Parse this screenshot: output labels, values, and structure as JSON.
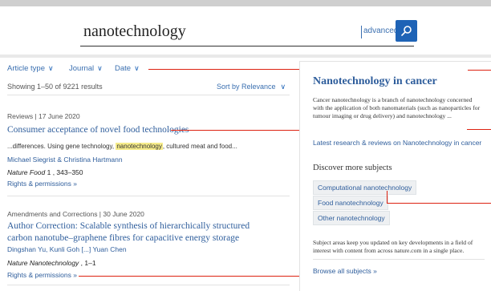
{
  "search": {
    "query": "nanotechnology",
    "advanced_label": "advanced"
  },
  "filters": [
    {
      "label": "Article type"
    },
    {
      "label": "Journal"
    },
    {
      "label": "Date"
    }
  ],
  "results_header": {
    "showing": "Showing 1–50 of 9221 results",
    "sort": "Sort by Relevance"
  },
  "results": [
    {
      "meta": "Reviews  |  17 June 2020",
      "title": "Consumer acceptance of novel food technologies",
      "snippet_before": "...differences. Using gene technology, ",
      "snippet_highlight": "nanotechnology",
      "snippet_after": ", cultured meat and food...",
      "authors": "Michael Siegrist & Christina Hartmann",
      "journal_name": "Nature Food",
      "journal_rest": " 1 , 343–350",
      "rights": "Rights & permissions »"
    },
    {
      "meta": "Amendments and Corrections  |  30 June 2020",
      "title": "Author Correction: Scalable synthesis of hierarchically structured carbon nanotube–graphene fibres for capacitive energy storage",
      "authors": "Dingshan Yu, Kunli Goh  [...]  Yuan Chen",
      "journal_name": "Nature Nanotechnology",
      "journal_rest": " , 1–1",
      "rights": "Rights & permissions »"
    }
  ],
  "panel": {
    "title": "Nanotechnology in cancer",
    "description": "Cancer nanotechnology is a branch of nanotechnology concerned with the application of both nanomaterials (such as nanoparticles for tumour imaging or drug delivery) and nanotechnology ...",
    "latest_link": "Latest research & reviews on Nanotechnology in cancer",
    "discover_heading": "Discover more subjects",
    "subjects": [
      "Computational nanotechnology",
      "Food nanotechnology",
      "Other nanotechnology"
    ],
    "note": "Subject areas keep you updated on key developments in a field of interest with content from across nature.com in a single place.",
    "browse_link": "Browse all subjects »"
  },
  "colors": {
    "link": "#2f5e9c",
    "accent": "#1e63b6",
    "annotation": "#dd2211",
    "highlight": "#f6ec8b"
  }
}
